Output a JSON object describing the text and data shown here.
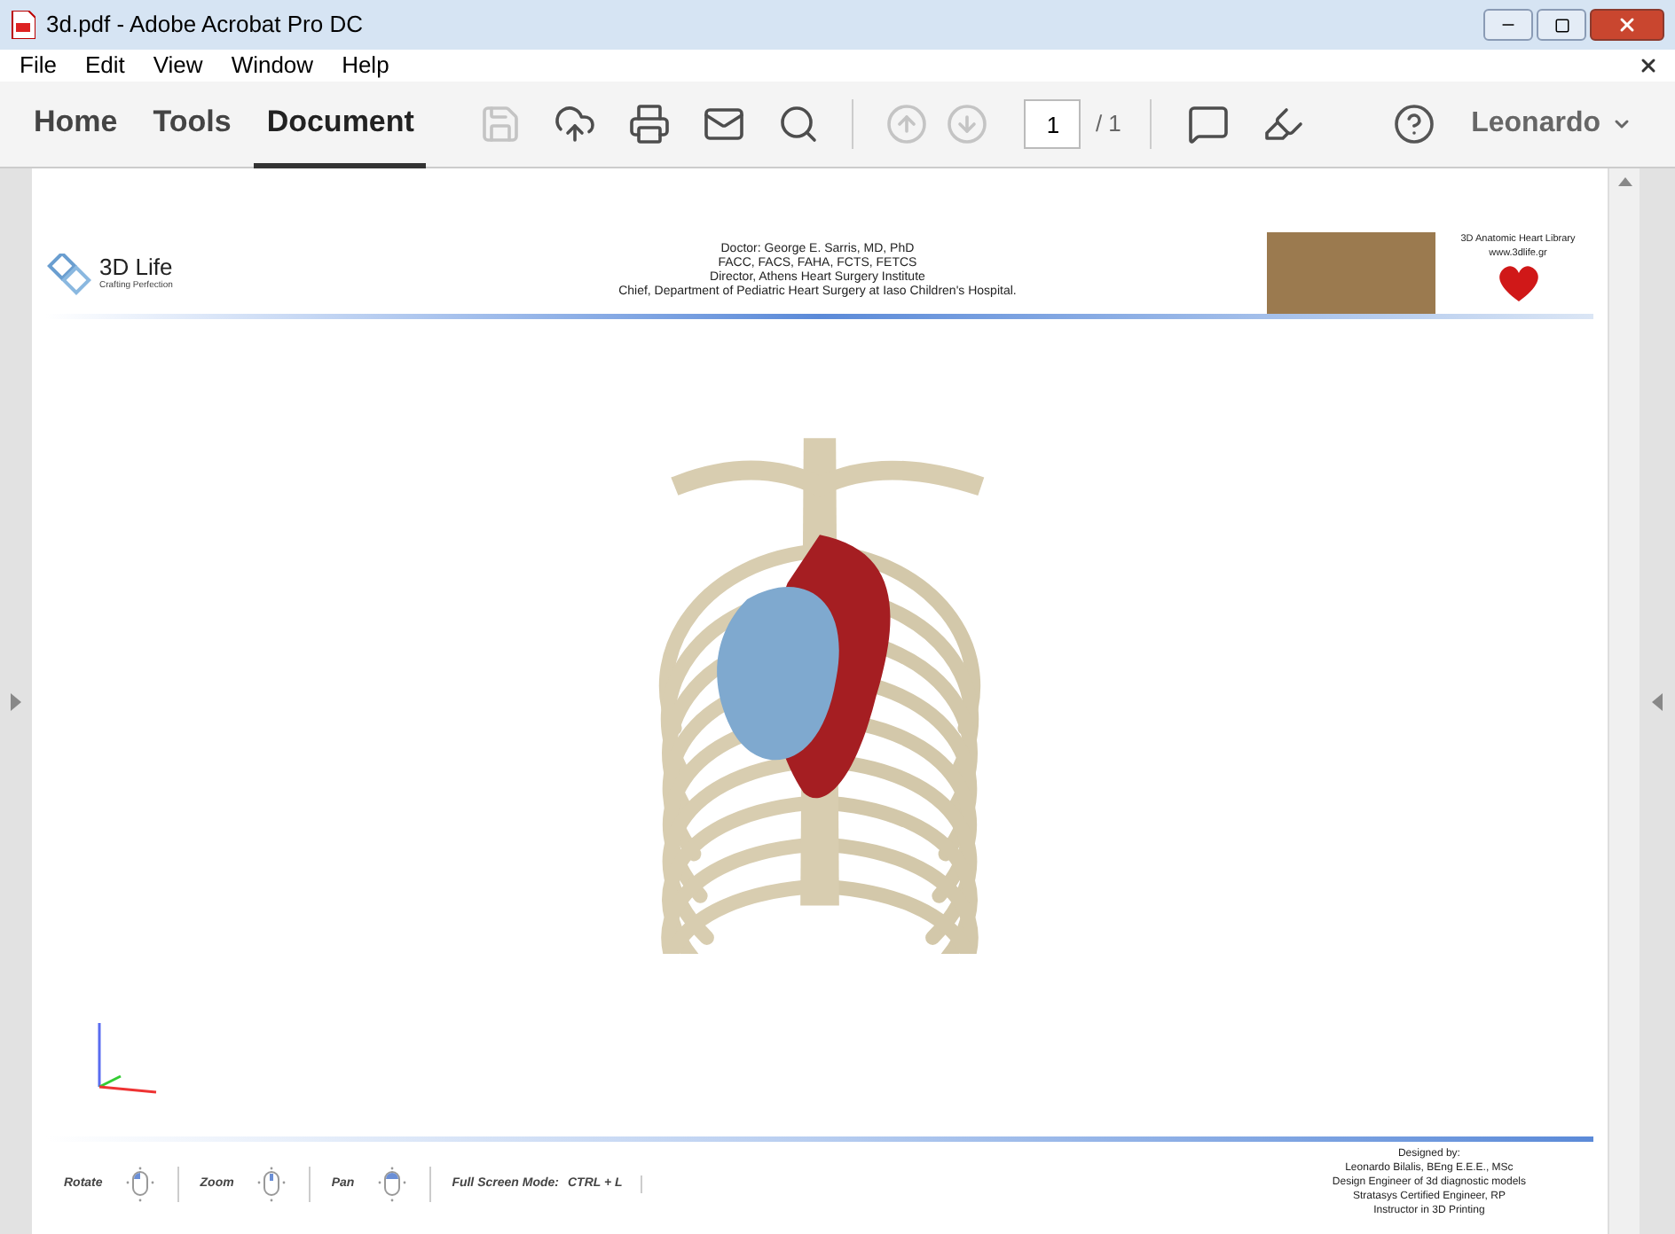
{
  "window": {
    "title": "3d.pdf - Adobe Acrobat Pro DC"
  },
  "menu": [
    "File",
    "Edit",
    "View",
    "Window",
    "Help"
  ],
  "tabs": [
    {
      "label": "Home",
      "selected": false
    },
    {
      "label": "Tools",
      "selected": false
    },
    {
      "label": "Document",
      "selected": true
    }
  ],
  "tools": [
    {
      "kind": "save",
      "disabled": true
    },
    {
      "kind": "upload",
      "disabled": false
    },
    {
      "kind": "print",
      "disabled": false
    },
    {
      "kind": "mail",
      "disabled": false
    },
    {
      "kind": "search",
      "disabled": false
    },
    {
      "kind": "page-up",
      "disabled": true
    },
    {
      "kind": "page-down",
      "disabled": true
    }
  ],
  "page_field": {
    "value": "1",
    "total": "/ 1"
  },
  "tools_right": [
    {
      "kind": "comment",
      "disabled": false
    },
    {
      "kind": "highlight",
      "disabled": false
    }
  ],
  "user": "Leonardo",
  "pdf": {
    "logo": "3D Life",
    "tagline": "Crafting Perfection",
    "header_lines": [
      "Doctor: George E. Sarris, MD, PhD",
      "FACC, FACS, FAHA, FCTS, FETCS",
      "Director, Athens Heart Surgery Institute",
      "Chief, Department of Pediatric Heart Surgery at Iaso Children's Hospital."
    ],
    "library": "3D Anatomic Heart Library",
    "website": "www.3dlife.gr",
    "controls": [
      {
        "label": "Rotate",
        "kind": "left"
      },
      {
        "label": "Zoom",
        "kind": "middle"
      },
      {
        "label": "Pan",
        "kind": "both"
      }
    ],
    "fullscreen": {
      "label": "Full Screen Mode:",
      "keys": "CTRL + L"
    },
    "credits": [
      "Designed by:",
      "Leonardo Bilalis, BEng E.E.E., MSc",
      "Design Engineer of 3d diagnostic models",
      "Stratasys Certified Engineer, RP",
      "Instructor in 3D Printing"
    ]
  }
}
